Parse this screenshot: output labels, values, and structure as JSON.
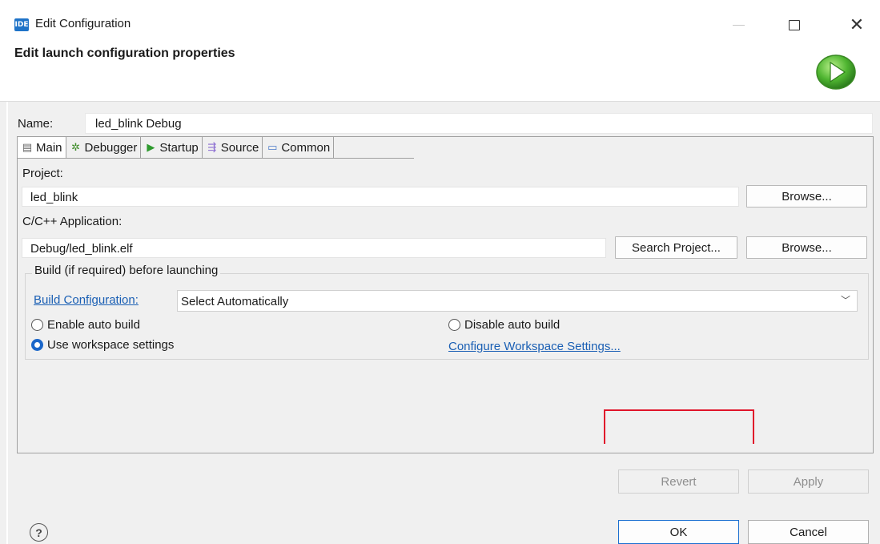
{
  "window": {
    "icon_text": "IDE",
    "title": "Edit Configuration",
    "header_title": "Edit launch configuration properties"
  },
  "name_field": {
    "label": "Name:",
    "value": "led_blink Debug"
  },
  "tabs": [
    {
      "label": "Main",
      "icon": "document-icon",
      "active": true
    },
    {
      "label": "Debugger",
      "icon": "bug-icon",
      "active": false
    },
    {
      "label": "Startup",
      "icon": "play-icon",
      "active": false
    },
    {
      "label": "Source",
      "icon": "source-icon",
      "active": false
    },
    {
      "label": "Common",
      "icon": "window-icon",
      "active": false
    }
  ],
  "main_tab": {
    "project_label": "Project:",
    "project_value": "led_blink",
    "project_browse": "Browse...",
    "app_label": "C/C++ Application:",
    "app_value": "Debug/led_blink.elf",
    "search_project": "Search Project...",
    "app_browse": "Browse...",
    "build_group": {
      "legend": "Build (if required) before launching",
      "config_link": "Build Configuration:",
      "config_value": "Select Automatically",
      "enable_auto": "Enable auto build",
      "disable_auto": "Disable auto build",
      "use_workspace": "Use workspace settings",
      "selected": "use_workspace",
      "configure_link": "Configure Workspace Settings..."
    }
  },
  "buttons": {
    "revert": "Revert",
    "apply": "Apply",
    "ok": "OK",
    "cancel": "Cancel",
    "help": "?"
  },
  "colors": {
    "accent": "#1a66c9",
    "highlight": "#e0142a",
    "link": "#1a5fb4"
  }
}
